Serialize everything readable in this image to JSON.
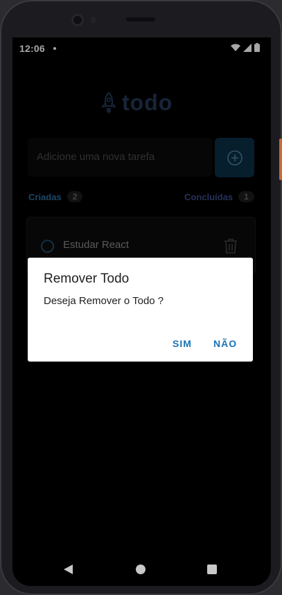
{
  "status_bar": {
    "time": "12:06"
  },
  "app": {
    "logo_text": "todo",
    "input_placeholder": "Adicione uma nova tarefa",
    "created": {
      "label": "Criadas",
      "count": "2"
    },
    "done": {
      "label": "Concluídas",
      "count": "1"
    },
    "tasks": [
      {
        "text": "Estudar React"
      }
    ]
  },
  "dialog": {
    "title": "Remover Todo",
    "message": "Deseja Remover o Todo ?",
    "yes_label": "SIM",
    "no_label": "NÃO"
  },
  "colors": {
    "accent_blue": "#1a73b8",
    "created_label": "#2b6e9e",
    "done_label": "#3c4a8a"
  },
  "icons": [
    "rocket-icon",
    "add-circle-icon",
    "trash-icon",
    "wifi-icon",
    "signal-icon",
    "battery-icon",
    "back-icon",
    "home-icon",
    "recents-icon"
  ]
}
